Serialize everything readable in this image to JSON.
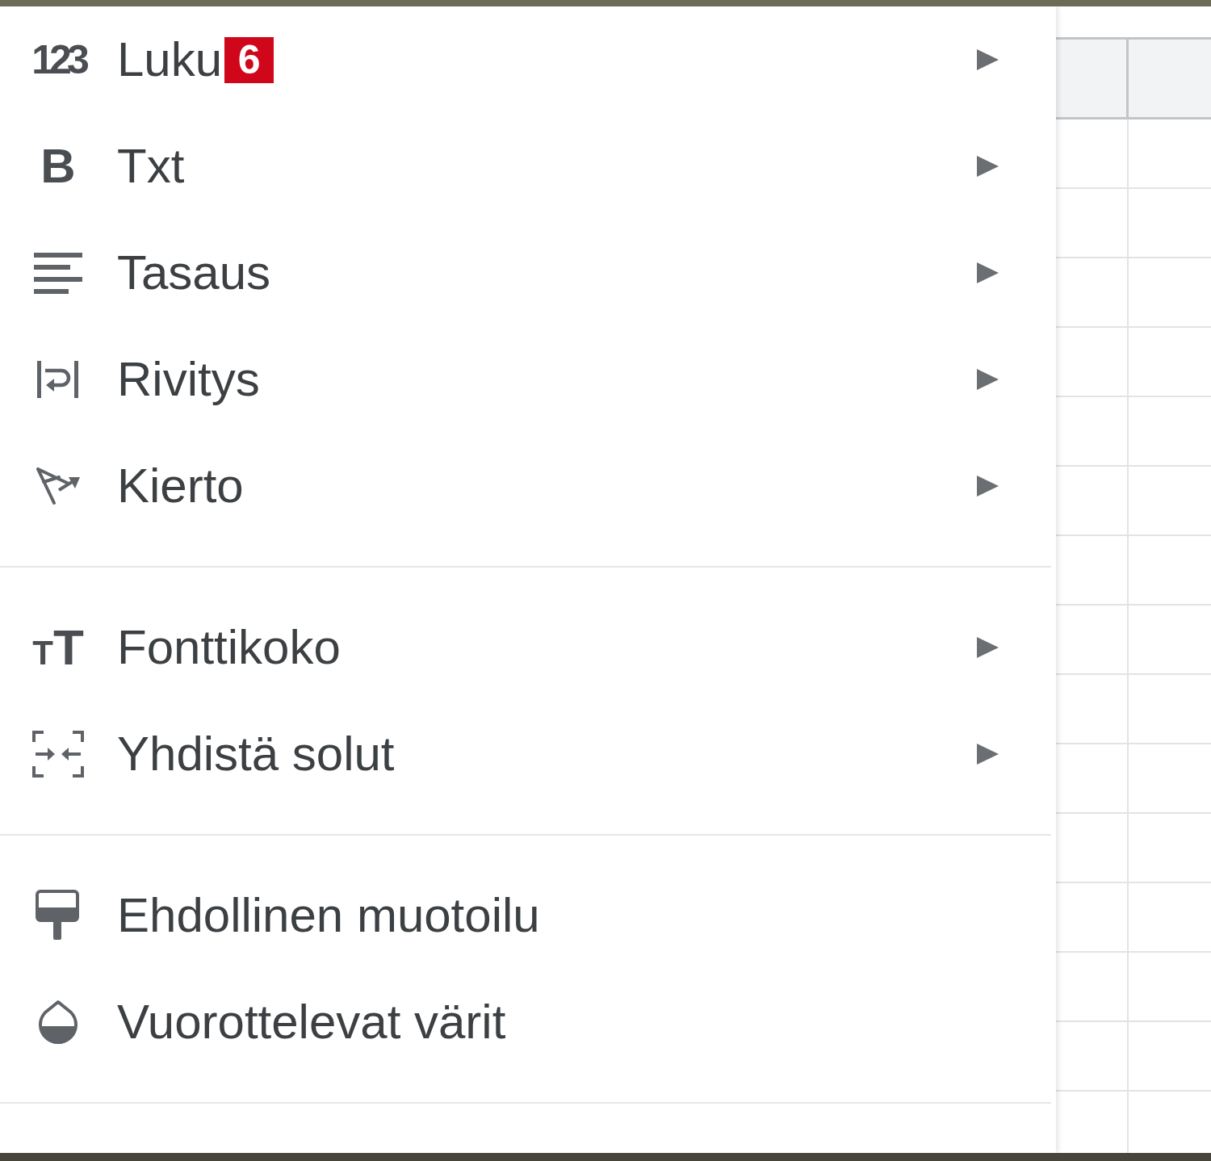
{
  "menu": {
    "groups": [
      {
        "items": [
          {
            "label": "Luku",
            "glyph": "123",
            "badge": "6",
            "submenu": true
          },
          {
            "label": "Txt",
            "glyph": "B",
            "submenu": true
          },
          {
            "label": "Tasaus",
            "submenu": true
          },
          {
            "label": "Rivitys",
            "submenu": true
          },
          {
            "label": "Kierto",
            "submenu": true
          }
        ]
      },
      {
        "items": [
          {
            "label": "Fonttikoko",
            "glyph": "TT",
            "submenu": true
          },
          {
            "label": "Yhdistä solut",
            "submenu": true
          }
        ]
      },
      {
        "items": [
          {
            "label": "Ehdollinen muotoilu",
            "submenu": false
          },
          {
            "label": "Vuorottelevat värit",
            "submenu": false
          }
        ]
      }
    ]
  }
}
